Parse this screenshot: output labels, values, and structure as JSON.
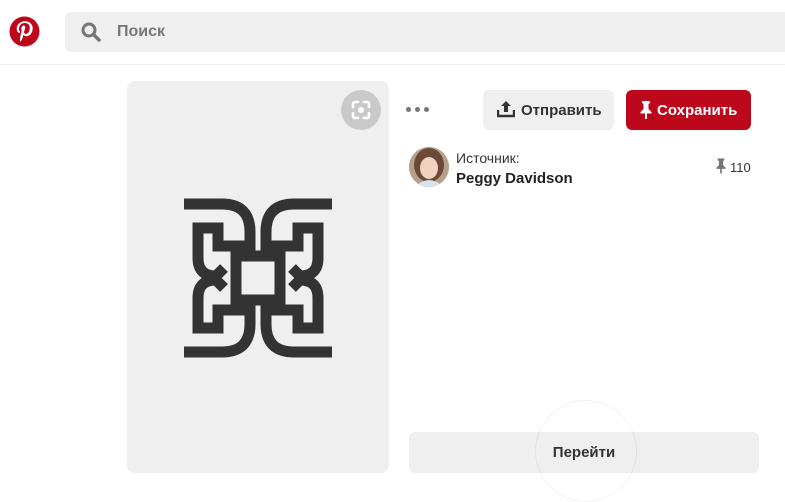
{
  "header": {
    "logo_icon": "pinterest-logo-icon",
    "search": {
      "placeholder": "Поиск",
      "icon": "search-icon"
    }
  },
  "pin": {
    "image_icon": "celtic-knot-logo",
    "visual_search_icon": "visual-search-icon",
    "more_icon": "more-dots-icon",
    "send_label": "Отправить",
    "save_label": "Сохранить",
    "source": {
      "label": "Источник:",
      "name": "Peggy Davidson"
    },
    "save_count": "110",
    "go_label": "Перейти"
  },
  "colors": {
    "brand_red": "#bd081c",
    "button_gray": "#efefef",
    "text_gray": "#767676"
  }
}
